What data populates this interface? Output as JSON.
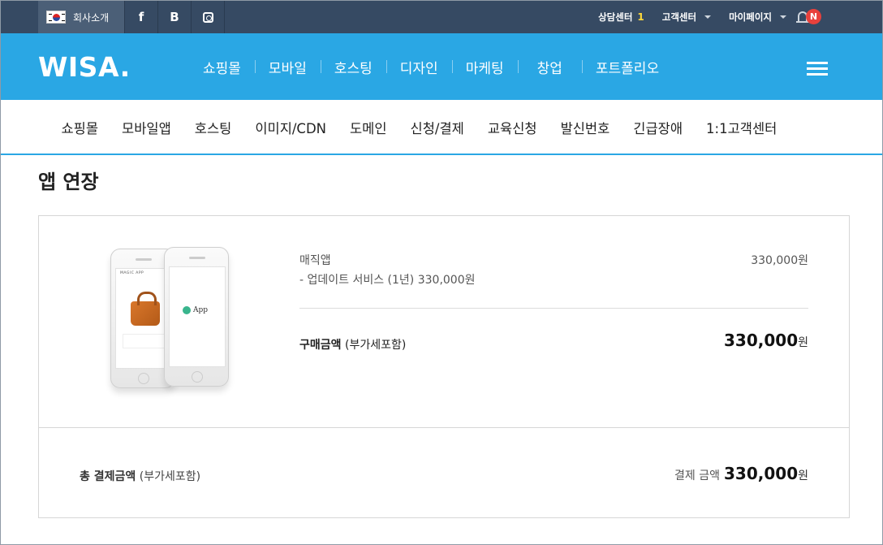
{
  "topbar": {
    "company_label": "회사소개",
    "social": {
      "facebook": "f",
      "blog": "B"
    },
    "consult_label": "상담센터",
    "consult_number": "1",
    "customer_center_label": "고객센터",
    "mypage_label": "마이페이지",
    "notification_badge": "N"
  },
  "logo": "WISA.",
  "mainnav": {
    "items": [
      "쇼핑몰",
      "모바일",
      "호스팅",
      "디자인",
      "마케팅",
      "창업",
      "포트폴리오"
    ]
  },
  "subnav": {
    "items": [
      "쇼핑몰",
      "모바일앱",
      "호스팅",
      "이미지/CDN",
      "도메인",
      "신청/결제",
      "교육신청",
      "발신번호",
      "긴급장애",
      "1:1고객센터"
    ]
  },
  "page": {
    "title": "앱 연장"
  },
  "order": {
    "product_name": "매직앱",
    "product_desc": "- 업데이트 서비스 (1년) 330,000원",
    "product_price": "330,000원",
    "phone_preview": {
      "back_screen_label": "MAGIC APP",
      "front_app_label": "App"
    },
    "purchase_label_bold": "구매금액",
    "purchase_label_note": "(부가세포함)",
    "purchase_amount": "330,000",
    "currency_unit": "원"
  },
  "total": {
    "label_bold": "총 결제금액",
    "label_note": "(부가세포함)",
    "prefix": "결제 금액",
    "amount": "330,000",
    "unit": "원"
  },
  "colors": {
    "topbar_bg": "#364a63",
    "brand_blue": "#2aa7e4",
    "badge_red": "#e8413c",
    "highlight_yellow": "#ffd93b"
  }
}
